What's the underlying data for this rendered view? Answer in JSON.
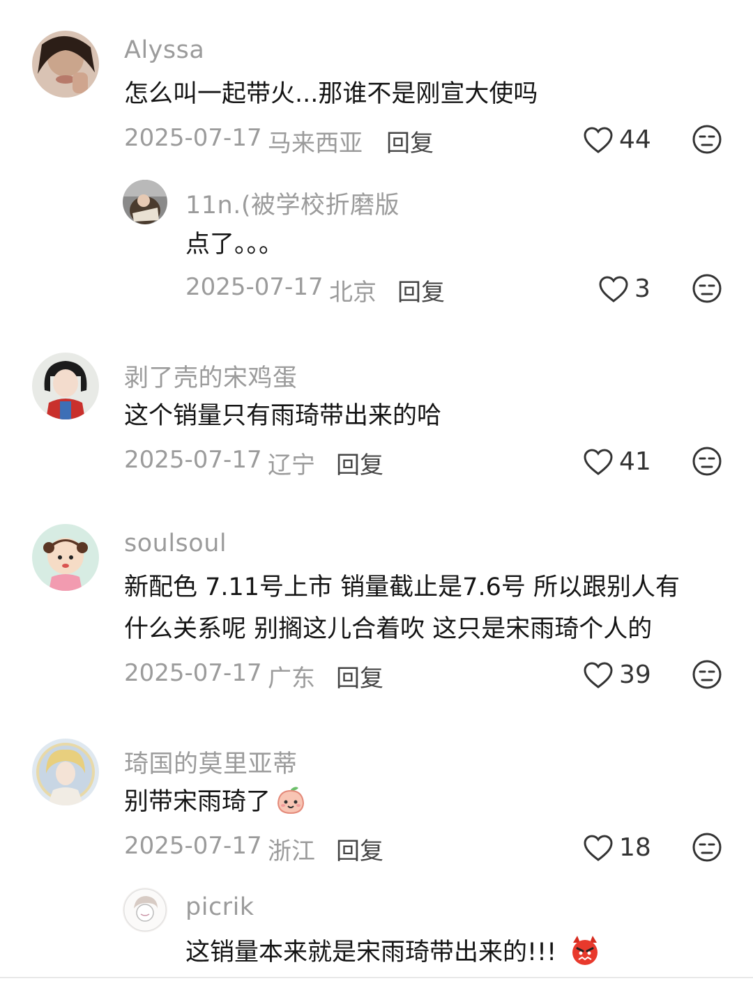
{
  "comments": [
    {
      "username": "Alyssa",
      "text_lines": [
        "怎么叫一起带火...那谁不是刚宣大使吗"
      ],
      "date": "2025-07-17",
      "location": "马来西亚",
      "reply_label": "回复",
      "likes": "44"
    },
    {
      "username": "11n.(被学校折磨版",
      "text_lines": [
        "点了。。。"
      ],
      "date": "2025-07-17",
      "location": "北京",
      "reply_label": "回复",
      "likes": "3"
    },
    {
      "username": "剥了壳的宋鸡蛋",
      "text_lines": [
        "这个销量只有雨琦带出来的哈"
      ],
      "date": "2025-07-17",
      "location": "辽宁",
      "reply_label": "回复",
      "likes": "41"
    },
    {
      "username": "soulsoul",
      "text_lines": [
        "新配色 7.11号上市 销量截止是7.6号 所以跟别人有",
        "什么关系呢 别搁这儿合着吹 这只是宋雨琦个人的"
      ],
      "date": "2025-07-17",
      "location": "广东",
      "reply_label": "回复",
      "likes": "39"
    },
    {
      "username": "琦国的莫里亚蒂",
      "text_lines": [
        "别带宋雨琦了"
      ],
      "emoji": "peach-smile-emoji",
      "date": "2025-07-17",
      "location": "浙江",
      "reply_label": "回复",
      "likes": "18"
    },
    {
      "username": "picrik",
      "text_lines": [
        "这销量本来就是宋雨琦带出来的!!!"
      ],
      "emoji": "angry-face-emoji"
    }
  ],
  "colors": {
    "username": "#9b9b9b",
    "body_text": "#141414",
    "meta": "#9b9b9b"
  }
}
